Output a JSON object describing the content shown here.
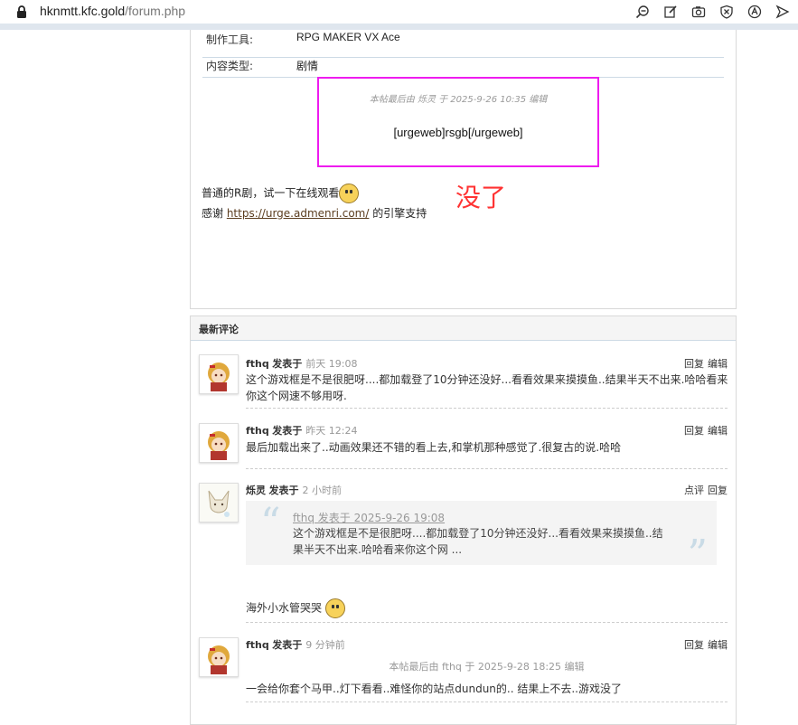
{
  "browser": {
    "url_host": "hknmtt.kfc.gold",
    "url_path": "/forum.php",
    "toolbar_icons": [
      "zoom-out-icon",
      "edit-icon",
      "camera-icon",
      "shield-icon",
      "translate-icon",
      "send-icon"
    ]
  },
  "post": {
    "meta": [
      {
        "label": "制作工具:",
        "value": "RPG MAKER VX Ace"
      },
      {
        "label": "内容类型:",
        "value": "剧情"
      }
    ],
    "edit_note": "本帖最后由 烁灵 于 2025-9-26 10:35 编辑",
    "code_text": "[urgeweb]rsgb[/urgeweb]",
    "annotation": "没了",
    "line1": "普通的R剧，试一下在线观看",
    "line2_prefix": "感谢 ",
    "line2_link": "https://urge.admenri.com/",
    "line2_suffix": " 的引擎支持"
  },
  "comments": {
    "title": "最新评论",
    "items": [
      {
        "author": "fthq",
        "posted": "发表于",
        "time": "前天 19:08",
        "actions": [
          "回复",
          "编辑"
        ],
        "text": "这个游戏框是不是很肥呀....都加载登了10分钟还没好...看看效果来摸摸鱼..结果半天不出来.哈哈看来你这个网速不够用呀."
      },
      {
        "author": "fthq",
        "posted": "发表于",
        "time": "昨天 12:24",
        "actions": [
          "回复",
          "编辑"
        ],
        "text": "最后加载出来了..动画效果还不错的看上去,和掌机那种感觉了.很复古的说.哈哈"
      },
      {
        "author": "烁灵",
        "posted": "发表于",
        "time": "2 小时前",
        "actions": [
          "点评",
          "回复"
        ],
        "quote_author": "fthq 发表于 2025-9-26 19:08",
        "quote_text": "这个游戏框是不是很肥呀....都加载登了10分钟还没好...看看效果来摸摸鱼..结果半天不出来.哈哈看来你这个网 ...",
        "text": "海外小水管哭哭"
      },
      {
        "author": "fthq",
        "posted": "发表于",
        "time": "9 分钟前",
        "actions": [
          "回复",
          "编辑"
        ],
        "edit_note": "本帖最后由 fthq 于 2025-9-28 18:25 编辑",
        "text": "一会给你套个马甲..灯下看看..难怪你的站点dundun的.. 结果上不去..游戏没了"
      }
    ]
  }
}
